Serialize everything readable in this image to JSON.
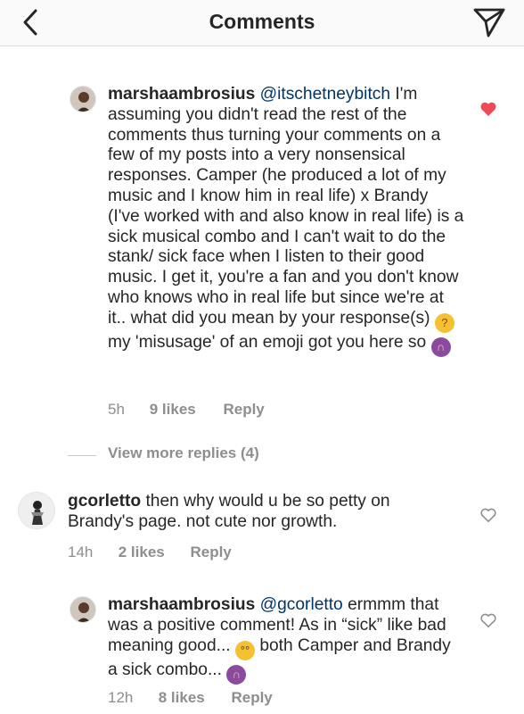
{
  "header": {
    "title": "Comments",
    "back_icon": "chevron-left-icon",
    "send_icon": "paper-plane-icon"
  },
  "comments": [
    {
      "username": "marshaambrosius",
      "mention": "@itschetneybitch",
      "text_1": "I'm assuming you didn't read the rest of the comments thus turning your comments on a few of my posts into a very nonsensical responses. Camper (he produced a lot of my music and I know him in real life) x Brandy (I've worked with and also know in real life) is a sick musical combo and I can't wait to do the stank/ sick face when I listen to their good music.  I get it, you're a fan and you don't know who knows who in real life but since we're at it.. what did you mean by your response(s)",
      "text_2": "my 'misusage' of an emoji got you here so",
      "time": "5h",
      "likes": "9 likes",
      "reply": "Reply",
      "liked": true,
      "heart_color": "#ed4956"
    },
    {
      "username": "gcorletto",
      "text_1": "then why would u be so petty on Brandy's page. not cute nor growth.",
      "time": "14h",
      "likes": "2 likes",
      "reply": "Reply",
      "liked": false
    },
    {
      "username": "marshaambrosius",
      "mention": "@gcorletto",
      "text_1": "ermmm that was a positive comment! As in “sick” like bad meaning good...",
      "text_2": "both Camper and Brandy a sick combo...",
      "time": "12h",
      "likes": "8 likes",
      "reply": "Reply",
      "liked": false
    }
  ],
  "view_more": "View more replies (4)"
}
